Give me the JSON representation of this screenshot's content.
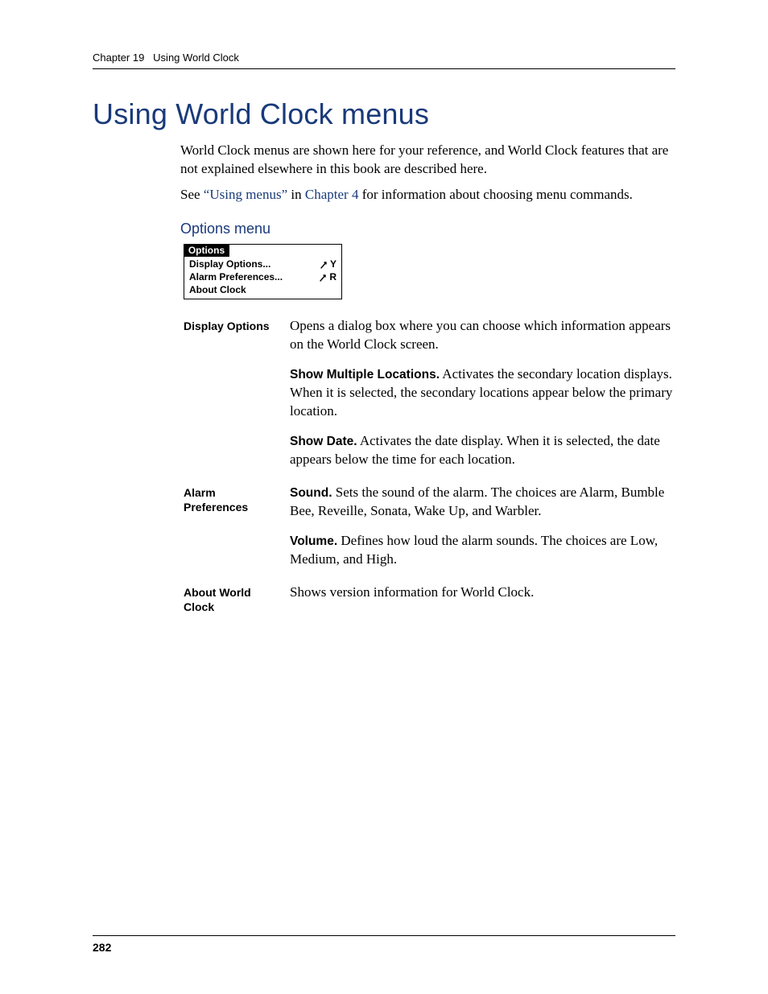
{
  "header": {
    "chapter_label": "Chapter 19",
    "chapter_title": "Using World Clock"
  },
  "title": "Using World Clock menus",
  "intro": {
    "p1": "World Clock menus are shown here for your reference, and World Clock features that are not explained elsewhere in this book are described here.",
    "p2_pre": "See ",
    "p2_link1": "“Using menus”",
    "p2_mid": " in ",
    "p2_link2": "Chapter 4",
    "p2_post": " for information about choosing menu commands."
  },
  "subhead": "Options menu",
  "menu_figure": {
    "tab": "Options",
    "items": [
      {
        "label": "Display Options...",
        "shortcut": "Y"
      },
      {
        "label": "Alarm Preferences...",
        "shortcut": "R"
      },
      {
        "label": "About Clock",
        "shortcut": ""
      }
    ]
  },
  "definitions": [
    {
      "term": "Display Options",
      "paras": [
        {
          "lead": "",
          "body": "Opens a dialog box where you can choose which information appears on the World Clock screen."
        },
        {
          "lead": "Show Multiple Locations.",
          "body": " Activates the secondary location displays. When it is selected, the secondary locations appear below the primary location."
        },
        {
          "lead": "Show Date.",
          "body": " Activates the date display. When it is selected, the date appears below the time for each location."
        }
      ]
    },
    {
      "term": "Alarm Preferences",
      "paras": [
        {
          "lead": "Sound.",
          "body": " Sets the sound of the alarm. The choices are Alarm, Bumble Bee, Reveille, Sonata, Wake Up, and Warbler."
        },
        {
          "lead": "Volume.",
          "body": " Defines how loud the alarm sounds. The choices are Low, Medium, and High."
        }
      ]
    },
    {
      "term": "About World Clock",
      "paras": [
        {
          "lead": "",
          "body": "Shows version information for World Clock."
        }
      ]
    }
  ],
  "page_number": "282"
}
